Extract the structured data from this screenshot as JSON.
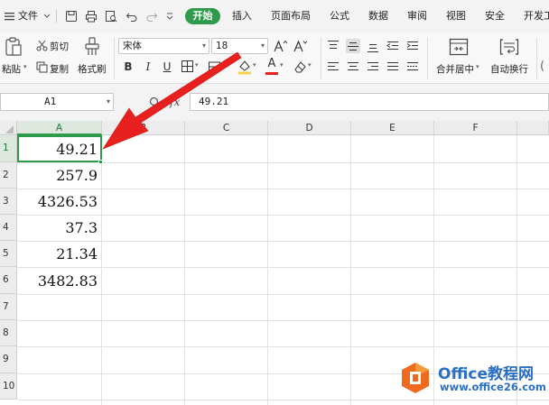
{
  "menubar": {
    "file_label": "文件",
    "tabs": [
      "开始",
      "插入",
      "页面布局",
      "公式",
      "数据",
      "审阅",
      "视图",
      "安全",
      "开发工"
    ],
    "active_tab": "开始"
  },
  "ribbon": {
    "clipboard": {
      "paste": "粘贴",
      "cut": "剪切",
      "copy": "复制",
      "format_painter": "格式刷"
    },
    "font": {
      "name": "宋体",
      "size": "18",
      "bold": "B",
      "italic": "I",
      "underline": "U",
      "font_color_glyph": "A"
    },
    "alignment": {
      "merge_center": "合并居中",
      "wrap_text": "自动换行"
    }
  },
  "formula_bar": {
    "cell_ref": "A1",
    "fx": "fx",
    "value": "49.21"
  },
  "sheet": {
    "columns": [
      "A",
      "B",
      "C",
      "D",
      "E",
      "F"
    ],
    "rows": [
      "1",
      "2",
      "3",
      "4",
      "5",
      "6",
      "7",
      "8",
      "9",
      "10"
    ],
    "column_a_values": [
      "49.21",
      "257.9",
      "4326.53",
      "37.3",
      "21.34",
      "3482.83"
    ],
    "selected_cell": "A1"
  },
  "annotation": {
    "color": "#e8201f"
  },
  "watermark": {
    "title": "Office教程网",
    "url": "www.office26.com"
  },
  "colors": {
    "accent": "#2e9a4b",
    "arrow": "#e8201f",
    "watermark": "#2b6fc2"
  }
}
